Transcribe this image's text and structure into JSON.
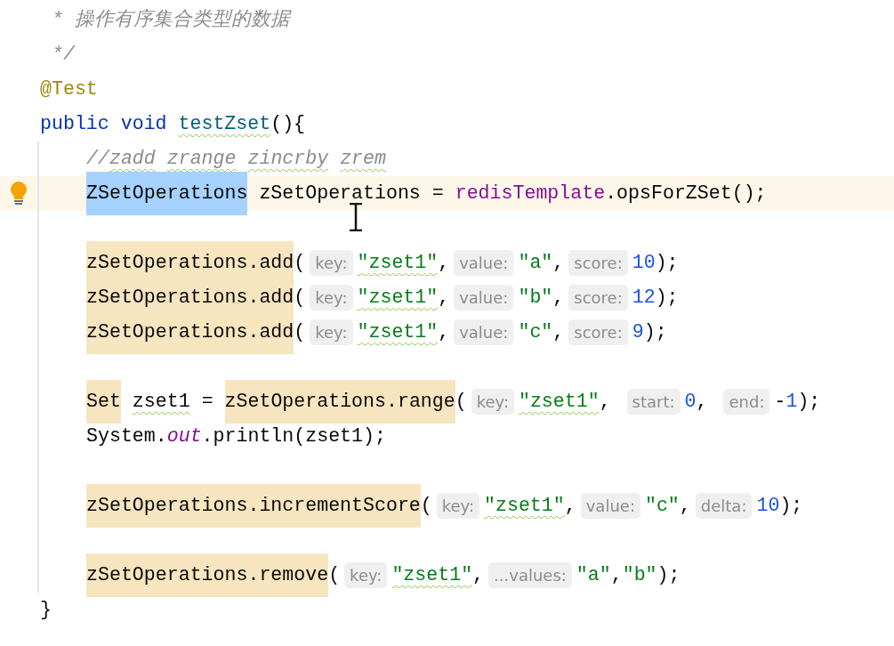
{
  "editor": {
    "header_lines": [
      {
        "tokens": [
          {
            "kind": "comment",
            "text": " * 操作有序集合类型的数据"
          }
        ]
      },
      {
        "tokens": [
          {
            "kind": "comment",
            "text": " */"
          }
        ]
      },
      {
        "tokens": [
          {
            "kind": "annotation",
            "text": "@Test"
          }
        ]
      },
      {
        "tokens": [
          {
            "kind": "keyword",
            "text": "public void "
          },
          {
            "kind": "method",
            "text": "testZset",
            "typo": true
          },
          {
            "kind": "plain",
            "text": "(){"
          }
        ]
      }
    ],
    "body_blocks": [
      {
        "lines": [
          {
            "tokens": [
              {
                "kind": "comment",
                "text": "//"
              },
              {
                "kind": "comment",
                "text": "zadd",
                "typo": true
              },
              {
                "kind": "comment",
                "text": " zrange",
                "typo": true
              },
              {
                "kind": "comment",
                "text": " zincrby",
                "typo": true
              },
              {
                "kind": "comment",
                "text": " zrem",
                "typo": true
              }
            ]
          },
          {
            "current": true,
            "tokens": [
              {
                "kind": "plain",
                "text": "ZSetOperations",
                "selected": true
              },
              {
                "kind": "plain",
                "text": " zSetOperations = "
              },
              {
                "kind": "field",
                "text": "redisTemplate"
              },
              {
                "kind": "plain",
                "text": ".opsForZSet();"
              }
            ]
          }
        ]
      },
      {
        "lines": [
          {
            "tokens": [
              {
                "kind": "plain",
                "text": "zSetOperations.add",
                "highlighted": true
              },
              {
                "kind": "plain",
                "text": "("
              },
              {
                "kind": "hint",
                "text": "key:"
              },
              {
                "kind": "string",
                "text": "\"zset1\"",
                "typo": true
              },
              {
                "kind": "plain",
                "text": ","
              },
              {
                "kind": "hint",
                "text": "value:"
              },
              {
                "kind": "string",
                "text": "\"a\""
              },
              {
                "kind": "plain",
                "text": ","
              },
              {
                "kind": "hint",
                "text": "score:"
              },
              {
                "kind": "number",
                "text": "10"
              },
              {
                "kind": "plain",
                "text": ");"
              }
            ]
          },
          {
            "tokens": [
              {
                "kind": "plain",
                "text": "zSetOperations.add",
                "highlighted": true
              },
              {
                "kind": "plain",
                "text": "("
              },
              {
                "kind": "hint",
                "text": "key:"
              },
              {
                "kind": "string",
                "text": "\"zset1\"",
                "typo": true
              },
              {
                "kind": "plain",
                "text": ","
              },
              {
                "kind": "hint",
                "text": "value:"
              },
              {
                "kind": "string",
                "text": "\"b\""
              },
              {
                "kind": "plain",
                "text": ","
              },
              {
                "kind": "hint",
                "text": "score:"
              },
              {
                "kind": "number",
                "text": "12"
              },
              {
                "kind": "plain",
                "text": ");"
              }
            ]
          },
          {
            "tokens": [
              {
                "kind": "plain",
                "text": "zSetOperations.add",
                "highlighted": true
              },
              {
                "kind": "plain",
                "text": "("
              },
              {
                "kind": "hint",
                "text": "key:"
              },
              {
                "kind": "string",
                "text": "\"zset1\"",
                "typo": true
              },
              {
                "kind": "plain",
                "text": ","
              },
              {
                "kind": "hint",
                "text": "value:"
              },
              {
                "kind": "string",
                "text": "\"c\""
              },
              {
                "kind": "plain",
                "text": ","
              },
              {
                "kind": "hint",
                "text": "score:"
              },
              {
                "kind": "number",
                "text": "9"
              },
              {
                "kind": "plain",
                "text": ");"
              }
            ]
          }
        ]
      },
      {
        "lines": [
          {
            "tokens": [
              {
                "kind": "plain",
                "text": "Set",
                "highlighted": true
              },
              {
                "kind": "plain",
                "text": " zset1",
                "typo": true
              },
              {
                "kind": "plain",
                "text": " = "
              },
              {
                "kind": "plain",
                "text": "zSetOperations.range",
                "highlighted": true
              },
              {
                "kind": "plain",
                "text": "("
              },
              {
                "kind": "hint",
                "text": "key:"
              },
              {
                "kind": "string",
                "text": "\"zset1\"",
                "typo": true
              },
              {
                "kind": "plain",
                "text": ", "
              },
              {
                "kind": "hint",
                "text": "start:"
              },
              {
                "kind": "number",
                "text": "0"
              },
              {
                "kind": "plain",
                "text": ", "
              },
              {
                "kind": "hint",
                "text": "end:"
              },
              {
                "kind": "plain",
                "text": "-"
              },
              {
                "kind": "number",
                "text": "1"
              },
              {
                "kind": "plain",
                "text": ");"
              }
            ]
          },
          {
            "tokens": [
              {
                "kind": "plain",
                "text": "System."
              },
              {
                "kind": "static",
                "text": "out"
              },
              {
                "kind": "plain",
                "text": ".println(zset1);"
              }
            ]
          }
        ]
      },
      {
        "lines": [
          {
            "tokens": [
              {
                "kind": "plain",
                "text": "zSetOperations.incrementScore",
                "highlighted": true
              },
              {
                "kind": "plain",
                "text": "("
              },
              {
                "kind": "hint",
                "text": "key:"
              },
              {
                "kind": "string",
                "text": "\"zset1\"",
                "typo": true
              },
              {
                "kind": "plain",
                "text": ","
              },
              {
                "kind": "hint",
                "text": "value:"
              },
              {
                "kind": "string",
                "text": "\"c\""
              },
              {
                "kind": "plain",
                "text": ","
              },
              {
                "kind": "hint",
                "text": "delta:"
              },
              {
                "kind": "number",
                "text": "10"
              },
              {
                "kind": "plain",
                "text": ");"
              }
            ]
          }
        ]
      },
      {
        "lines": [
          {
            "tokens": [
              {
                "kind": "plain",
                "text": "zSetOperations.remove",
                "highlighted": true
              },
              {
                "kind": "plain",
                "text": "("
              },
              {
                "kind": "hint",
                "text": "key:"
              },
              {
                "kind": "string",
                "text": "\"zset1\"",
                "typo": true
              },
              {
                "kind": "plain",
                "text": ","
              },
              {
                "kind": "hint",
                "text": "...values:"
              },
              {
                "kind": "string",
                "text": "\"a\""
              },
              {
                "kind": "plain",
                "text": ","
              },
              {
                "kind": "string",
                "text": "\"b\""
              },
              {
                "kind": "plain",
                "text": ");"
              }
            ]
          }
        ]
      }
    ],
    "closing_lines": [
      {
        "tokens": [
          {
            "kind": "plain",
            "text": "}"
          }
        ]
      }
    ]
  }
}
